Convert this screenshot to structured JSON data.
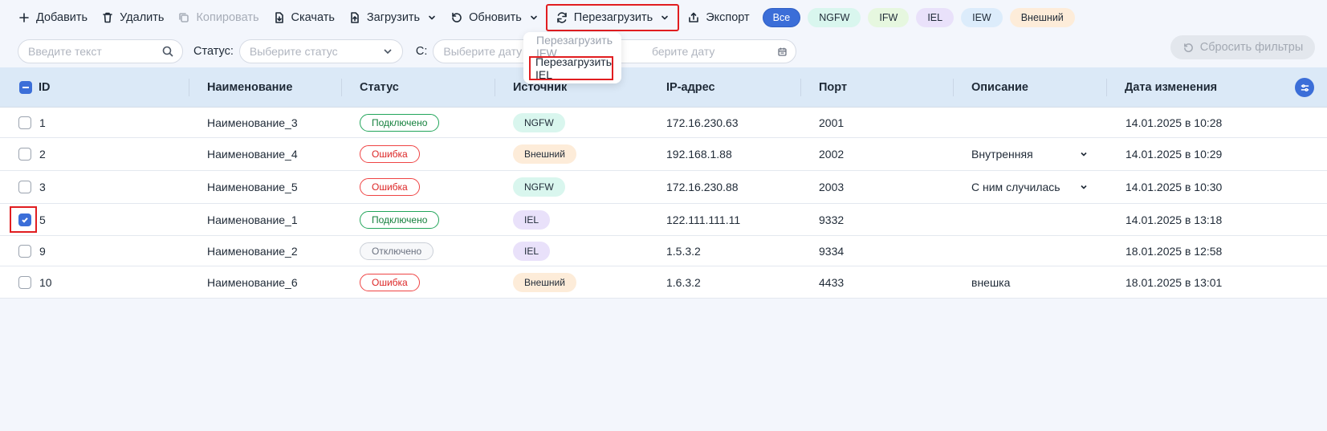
{
  "toolbar": {
    "add": "Добавить",
    "delete": "Удалить",
    "copy": "Копировать",
    "download": "Скачать",
    "upload": "Загрузить",
    "refresh": "Обновить",
    "reload": "Перезагрузить",
    "export": "Экспорт",
    "chips": [
      {
        "label": "Все",
        "bg": "#3b6ed8",
        "color": "#ffffff"
      },
      {
        "label": "NGFW",
        "bg": "#d9f6ee",
        "color": "#1f2a37"
      },
      {
        "label": "IFW",
        "bg": "#e6f7df",
        "color": "#1f2a37"
      },
      {
        "label": "IEL",
        "bg": "#e9e1fa",
        "color": "#1f2a37"
      },
      {
        "label": "IEW",
        "bg": "#dcecfb",
        "color": "#1f2a37"
      },
      {
        "label": "Внешний",
        "bg": "#fdecd9",
        "color": "#1f2a37"
      }
    ]
  },
  "dropdown": {
    "items": [
      "Перезагрузить IFW",
      "Перезагрузить IEL"
    ]
  },
  "filters": {
    "search_placeholder": "Введите текст",
    "status_label": "Статус:",
    "status_placeholder": "Выберите статус",
    "from_label": "С:",
    "date_placeholder": "Выберите дату",
    "date2_placeholder": "берите дату",
    "reset": "Сбросить фильтры"
  },
  "table": {
    "columns": [
      "ID",
      "Наименование",
      "Статус",
      "Источник",
      "IP-адрес",
      "Порт",
      "Описание",
      "Дата изменения"
    ],
    "rows": [
      {
        "id": "1",
        "name": "Наименование_3",
        "status": "Подключено",
        "status_type": "ok",
        "source": "NGFW",
        "ip": "172.16.230.63",
        "port": "2001",
        "desc": "",
        "date": "14.01.2025 в 10:28",
        "checked": false
      },
      {
        "id": "2",
        "name": "Наименование_4",
        "status": "Ошибка",
        "status_type": "err",
        "source": "Внешний",
        "ip": "192.168.1.88",
        "port": "2002",
        "desc": "Внутренняя",
        "date": "14.01.2025 в 10:29",
        "checked": false
      },
      {
        "id": "3",
        "name": "Наименование_5",
        "status": "Ошибка",
        "status_type": "err",
        "source": "NGFW",
        "ip": "172.16.230.88",
        "port": "2003",
        "desc": "С ним случилась",
        "date": "14.01.2025 в 10:30",
        "checked": false
      },
      {
        "id": "5",
        "name": "Наименование_1",
        "status": "Подключено",
        "status_type": "ok",
        "source": "IEL",
        "ip": "122.111.111.11",
        "port": "9332",
        "desc": "",
        "date": "14.01.2025 в 13:18",
        "checked": true
      },
      {
        "id": "9",
        "name": "Наименование_2",
        "status": "Отключено",
        "status_type": "off",
        "source": "IEL",
        "ip": "1.5.3.2",
        "port": "9334",
        "desc": "",
        "date": "18.01.2025 в 12:58",
        "checked": false
      },
      {
        "id": "10",
        "name": "Наименование_6",
        "status": "Ошибка",
        "status_type": "err",
        "source": "Внешний",
        "ip": "1.6.3.2",
        "port": "4433",
        "desc": "внешка",
        "date": "18.01.2025 в 13:01",
        "checked": false
      }
    ]
  },
  "colors": {
    "accent": "#3b6ed8",
    "highlight": "#e11d20",
    "source_NGFW": "#d9f6ee",
    "source_IEL": "#e9e1fa",
    "source_Внешний": "#fdecd9"
  }
}
